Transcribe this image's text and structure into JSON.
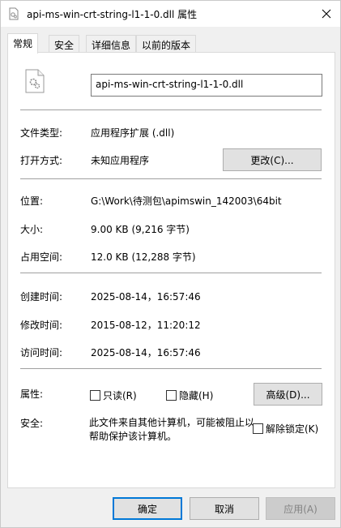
{
  "window": {
    "title": "api-ms-win-crt-string-l1-1-0.dll 属性"
  },
  "tabs": [
    {
      "label": "常规"
    },
    {
      "label": "安全"
    },
    {
      "label": "详细信息"
    },
    {
      "label": "以前的版本"
    }
  ],
  "general": {
    "filename": "api-ms-win-crt-string-l1-1-0.dll",
    "file_type_label": "文件类型:",
    "file_type_value": "应用程序扩展 (.dll)",
    "open_with_label": "打开方式:",
    "open_with_value": "未知应用程序",
    "change_button": "更改(C)...",
    "location_label": "位置:",
    "location_value": "G:\\Work\\待测包\\apimswin_142003\\64bit",
    "size_label": "大小:",
    "size_value": "9.00 KB (9,216 字节)",
    "size_on_disk_label": "占用空间:",
    "size_on_disk_value": "12.0 KB (12,288 字节)",
    "created_label": "创建时间:",
    "created_value": "2025-08-14，16:57:46",
    "modified_label": "修改时间:",
    "modified_value": "2015-08-12，11:20:12",
    "accessed_label": "访问时间:",
    "accessed_value": "2025-08-14，16:57:46",
    "attributes_label": "属性:",
    "readonly_label": "只读(R)",
    "hidden_label": "隐藏(H)",
    "advanced_button": "高级(D)...",
    "security_label": "安全:",
    "security_text": "此文件来自其他计算机，可能被阻止以帮助保护该计算机。",
    "unblock_label": "解除锁定(K)"
  },
  "footer": {
    "ok": "确定",
    "cancel": "取消",
    "apply": "应用(A)"
  }
}
